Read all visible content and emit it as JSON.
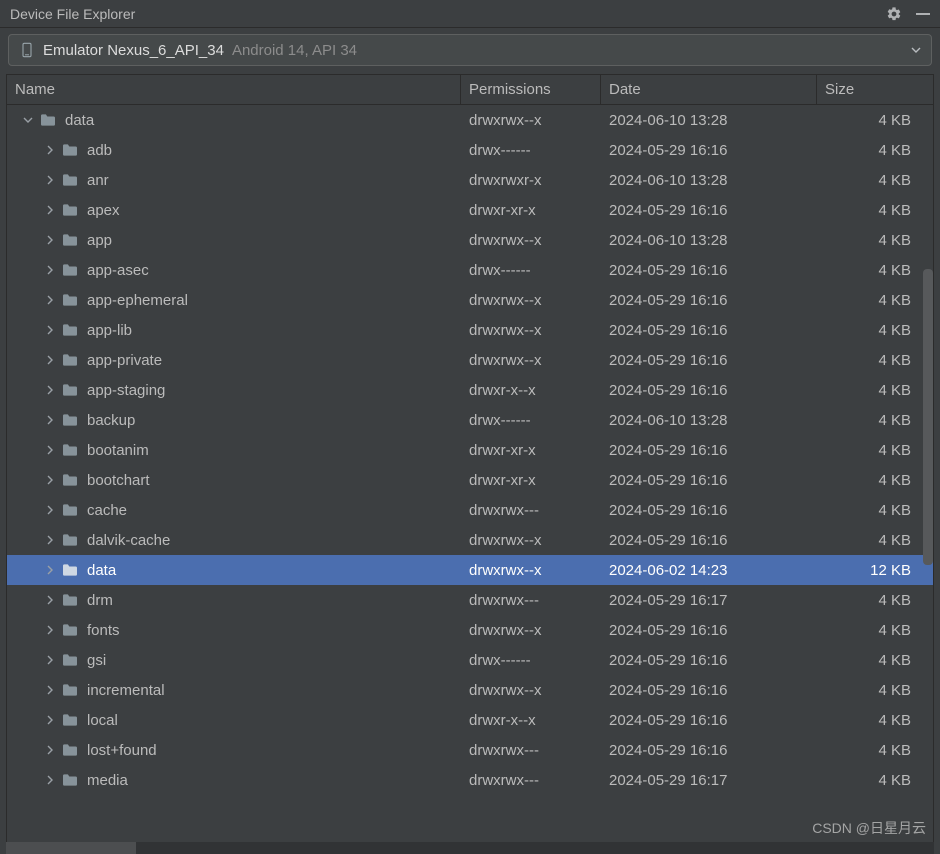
{
  "header": {
    "title": "Device File Explorer"
  },
  "device": {
    "name": "Emulator Nexus_6_API_34",
    "info": "Android 14, API 34"
  },
  "columns": {
    "name": "Name",
    "permissions": "Permissions",
    "date": "Date",
    "size": "Size"
  },
  "rows": [
    {
      "depth": 0,
      "expanded": true,
      "selected": false,
      "name": "data",
      "perm": "drwxrwx--x",
      "date": "2024-06-10 13:28",
      "size": "4 KB"
    },
    {
      "depth": 1,
      "expanded": false,
      "selected": false,
      "name": "adb",
      "perm": "drwx------",
      "date": "2024-05-29 16:16",
      "size": "4 KB"
    },
    {
      "depth": 1,
      "expanded": false,
      "selected": false,
      "name": "anr",
      "perm": "drwxrwxr-x",
      "date": "2024-06-10 13:28",
      "size": "4 KB"
    },
    {
      "depth": 1,
      "expanded": false,
      "selected": false,
      "name": "apex",
      "perm": "drwxr-xr-x",
      "date": "2024-05-29 16:16",
      "size": "4 KB"
    },
    {
      "depth": 1,
      "expanded": false,
      "selected": false,
      "name": "app",
      "perm": "drwxrwx--x",
      "date": "2024-06-10 13:28",
      "size": "4 KB"
    },
    {
      "depth": 1,
      "expanded": false,
      "selected": false,
      "name": "app-asec",
      "perm": "drwx------",
      "date": "2024-05-29 16:16",
      "size": "4 KB"
    },
    {
      "depth": 1,
      "expanded": false,
      "selected": false,
      "name": "app-ephemeral",
      "perm": "drwxrwx--x",
      "date": "2024-05-29 16:16",
      "size": "4 KB"
    },
    {
      "depth": 1,
      "expanded": false,
      "selected": false,
      "name": "app-lib",
      "perm": "drwxrwx--x",
      "date": "2024-05-29 16:16",
      "size": "4 KB"
    },
    {
      "depth": 1,
      "expanded": false,
      "selected": false,
      "name": "app-private",
      "perm": "drwxrwx--x",
      "date": "2024-05-29 16:16",
      "size": "4 KB"
    },
    {
      "depth": 1,
      "expanded": false,
      "selected": false,
      "name": "app-staging",
      "perm": "drwxr-x--x",
      "date": "2024-05-29 16:16",
      "size": "4 KB"
    },
    {
      "depth": 1,
      "expanded": false,
      "selected": false,
      "name": "backup",
      "perm": "drwx------",
      "date": "2024-06-10 13:28",
      "size": "4 KB"
    },
    {
      "depth": 1,
      "expanded": false,
      "selected": false,
      "name": "bootanim",
      "perm": "drwxr-xr-x",
      "date": "2024-05-29 16:16",
      "size": "4 KB"
    },
    {
      "depth": 1,
      "expanded": false,
      "selected": false,
      "name": "bootchart",
      "perm": "drwxr-xr-x",
      "date": "2024-05-29 16:16",
      "size": "4 KB"
    },
    {
      "depth": 1,
      "expanded": false,
      "selected": false,
      "name": "cache",
      "perm": "drwxrwx---",
      "date": "2024-05-29 16:16",
      "size": "4 KB"
    },
    {
      "depth": 1,
      "expanded": false,
      "selected": false,
      "name": "dalvik-cache",
      "perm": "drwxrwx--x",
      "date": "2024-05-29 16:16",
      "size": "4 KB"
    },
    {
      "depth": 1,
      "expanded": false,
      "selected": true,
      "name": "data",
      "perm": "drwxrwx--x",
      "date": "2024-06-02 14:23",
      "size": "12 KB"
    },
    {
      "depth": 1,
      "expanded": false,
      "selected": false,
      "name": "drm",
      "perm": "drwxrwx---",
      "date": "2024-05-29 16:17",
      "size": "4 KB"
    },
    {
      "depth": 1,
      "expanded": false,
      "selected": false,
      "name": "fonts",
      "perm": "drwxrwx--x",
      "date": "2024-05-29 16:16",
      "size": "4 KB"
    },
    {
      "depth": 1,
      "expanded": false,
      "selected": false,
      "name": "gsi",
      "perm": "drwx------",
      "date": "2024-05-29 16:16",
      "size": "4 KB"
    },
    {
      "depth": 1,
      "expanded": false,
      "selected": false,
      "name": "incremental",
      "perm": "drwxrwx--x",
      "date": "2024-05-29 16:16",
      "size": "4 KB"
    },
    {
      "depth": 1,
      "expanded": false,
      "selected": false,
      "name": "local",
      "perm": "drwxr-x--x",
      "date": "2024-05-29 16:16",
      "size": "4 KB"
    },
    {
      "depth": 1,
      "expanded": false,
      "selected": false,
      "name": "lost+found",
      "perm": "drwxrwx---",
      "date": "2024-05-29 16:16",
      "size": "4 KB"
    },
    {
      "depth": 1,
      "expanded": false,
      "selected": false,
      "name": "media",
      "perm": "drwxrwx---",
      "date": "2024-05-29 16:17",
      "size": "4 KB"
    }
  ],
  "watermark": "CSDN @日星月云"
}
